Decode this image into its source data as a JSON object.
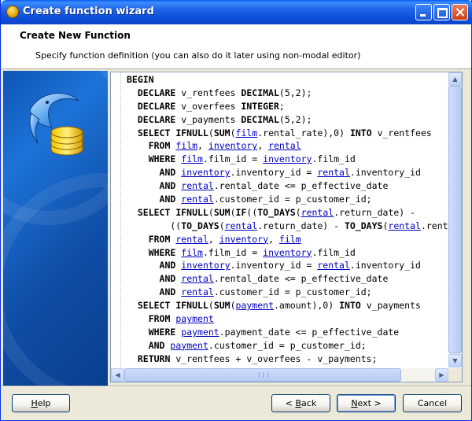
{
  "window": {
    "title": "Create function wizard"
  },
  "header": {
    "title": "Create New Function",
    "subtitle": "Specify function definition (you can also do it later using non-modal editor)"
  },
  "editor": {
    "lines": [
      [
        {
          "t": "BEGIN",
          "k": "kw"
        }
      ],
      [
        {
          "t": "  "
        },
        {
          "t": "DECLARE",
          "k": "kw"
        },
        {
          "t": " v_rentfees "
        },
        {
          "t": "DECIMAL",
          "k": "kw"
        },
        {
          "t": "(5,2);"
        }
      ],
      [
        {
          "t": "  "
        },
        {
          "t": "DECLARE",
          "k": "kw"
        },
        {
          "t": " v_overfees "
        },
        {
          "t": "INTEGER",
          "k": "kw"
        },
        {
          "t": ";"
        }
      ],
      [
        {
          "t": "  "
        },
        {
          "t": "DECLARE",
          "k": "kw"
        },
        {
          "t": " v_payments "
        },
        {
          "t": "DECIMAL",
          "k": "kw"
        },
        {
          "t": "(5,2);"
        }
      ],
      [
        {
          "t": "  "
        },
        {
          "t": "SELECT IFNULL",
          "k": "kw"
        },
        {
          "t": "("
        },
        {
          "t": "SUM",
          "k": "kw"
        },
        {
          "t": "("
        },
        {
          "t": "film",
          "k": "tbl"
        },
        {
          "t": ".rental_rate),0) "
        },
        {
          "t": "INTO",
          "k": "kw"
        },
        {
          "t": " v_rentfees"
        }
      ],
      [
        {
          "t": "    "
        },
        {
          "t": "FROM",
          "k": "kw"
        },
        {
          "t": " "
        },
        {
          "t": "film",
          "k": "tbl"
        },
        {
          "t": ", "
        },
        {
          "t": "inventory",
          "k": "tbl"
        },
        {
          "t": ", "
        },
        {
          "t": "rental",
          "k": "tbl"
        }
      ],
      [
        {
          "t": "    "
        },
        {
          "t": "WHERE",
          "k": "kw"
        },
        {
          "t": " "
        },
        {
          "t": "film",
          "k": "tbl"
        },
        {
          "t": ".film_id = "
        },
        {
          "t": "inventory",
          "k": "tbl"
        },
        {
          "t": ".film_id"
        }
      ],
      [
        {
          "t": "      "
        },
        {
          "t": "AND",
          "k": "kw"
        },
        {
          "t": " "
        },
        {
          "t": "inventory",
          "k": "tbl"
        },
        {
          "t": ".inventory_id = "
        },
        {
          "t": "rental",
          "k": "tbl"
        },
        {
          "t": ".inventory_id"
        }
      ],
      [
        {
          "t": "      "
        },
        {
          "t": "AND",
          "k": "kw"
        },
        {
          "t": " "
        },
        {
          "t": "rental",
          "k": "tbl"
        },
        {
          "t": ".rental_date <= p_effective_date"
        }
      ],
      [
        {
          "t": "      "
        },
        {
          "t": "AND",
          "k": "kw"
        },
        {
          "t": " "
        },
        {
          "t": "rental",
          "k": "tbl"
        },
        {
          "t": ".customer_id = p_customer_id;"
        }
      ],
      [
        {
          "t": "  "
        },
        {
          "t": "SELECT IFNULL",
          "k": "kw"
        },
        {
          "t": "("
        },
        {
          "t": "SUM",
          "k": "kw"
        },
        {
          "t": "("
        },
        {
          "t": "IF",
          "k": "kw"
        },
        {
          "t": "(("
        },
        {
          "t": "TO_DAYS",
          "k": "kw"
        },
        {
          "t": "("
        },
        {
          "t": "rental",
          "k": "tbl"
        },
        {
          "t": ".return_date) - "
        }
      ],
      [
        {
          "t": "        (("
        },
        {
          "t": "TO_DAYS",
          "k": "kw"
        },
        {
          "t": "("
        },
        {
          "t": "rental",
          "k": "tbl"
        },
        {
          "t": ".return_date) - "
        },
        {
          "t": "TO_DAYS",
          "k": "kw"
        },
        {
          "t": "("
        },
        {
          "t": "rental",
          "k": "tbl"
        },
        {
          "t": ".rental_date)"
        }
      ],
      [
        {
          "t": "    "
        },
        {
          "t": "FROM",
          "k": "kw"
        },
        {
          "t": " "
        },
        {
          "t": "rental",
          "k": "tbl"
        },
        {
          "t": ", "
        },
        {
          "t": "inventory",
          "k": "tbl"
        },
        {
          "t": ", "
        },
        {
          "t": "film",
          "k": "tbl"
        }
      ],
      [
        {
          "t": "    "
        },
        {
          "t": "WHERE",
          "k": "kw"
        },
        {
          "t": " "
        },
        {
          "t": "film",
          "k": "tbl"
        },
        {
          "t": ".film_id = "
        },
        {
          "t": "inventory",
          "k": "tbl"
        },
        {
          "t": ".film_id"
        }
      ],
      [
        {
          "t": "      "
        },
        {
          "t": "AND",
          "k": "kw"
        },
        {
          "t": " "
        },
        {
          "t": "inventory",
          "k": "tbl"
        },
        {
          "t": ".inventory_id = "
        },
        {
          "t": "rental",
          "k": "tbl"
        },
        {
          "t": ".inventory_id"
        }
      ],
      [
        {
          "t": "      "
        },
        {
          "t": "AND",
          "k": "kw"
        },
        {
          "t": " "
        },
        {
          "t": "rental",
          "k": "tbl"
        },
        {
          "t": ".rental_date <= p_effective_date"
        }
      ],
      [
        {
          "t": "      "
        },
        {
          "t": "AND",
          "k": "kw"
        },
        {
          "t": " "
        },
        {
          "t": "rental",
          "k": "tbl"
        },
        {
          "t": ".customer_id = p_customer_id;"
        }
      ],
      [
        {
          "t": "  "
        },
        {
          "t": "SELECT IFNULL",
          "k": "kw"
        },
        {
          "t": "("
        },
        {
          "t": "SUM",
          "k": "kw"
        },
        {
          "t": "("
        },
        {
          "t": "payment",
          "k": "tbl"
        },
        {
          "t": ".amount),0) "
        },
        {
          "t": "INTO",
          "k": "kw"
        },
        {
          "t": " v_payments"
        }
      ],
      [
        {
          "t": "    "
        },
        {
          "t": "FROM",
          "k": "kw"
        },
        {
          "t": " "
        },
        {
          "t": "payment",
          "k": "tbl"
        }
      ],
      [
        {
          "t": "    "
        },
        {
          "t": "WHERE",
          "k": "kw"
        },
        {
          "t": " "
        },
        {
          "t": "payment",
          "k": "tbl"
        },
        {
          "t": ".payment_date <= p_effective_date"
        }
      ],
      [
        {
          "t": "    "
        },
        {
          "t": "AND",
          "k": "kw"
        },
        {
          "t": " "
        },
        {
          "t": "payment",
          "k": "tbl"
        },
        {
          "t": ".customer_id = p_customer_id;"
        }
      ],
      [
        {
          "t": "  "
        },
        {
          "t": "RETURN",
          "k": "kw"
        },
        {
          "t": " v_rentfees + v_overfees - v_payments;"
        }
      ]
    ]
  },
  "buttons": {
    "help": {
      "pre": "",
      "key": "H",
      "post": "elp"
    },
    "back": {
      "pre": "< ",
      "key": "B",
      "post": "ack"
    },
    "next": {
      "pre": "",
      "key": "N",
      "post": "ext >"
    },
    "cancel": {
      "pre": "Cancel",
      "key": "",
      "post": ""
    }
  },
  "colors": {
    "title_bar": "#0b4bd6",
    "sidebar": "#0f4fa8",
    "table_link": "#0000c0"
  },
  "icons": {
    "sidebar_logo": "mysql-dolphin-database-icon",
    "app": "app-icon"
  }
}
